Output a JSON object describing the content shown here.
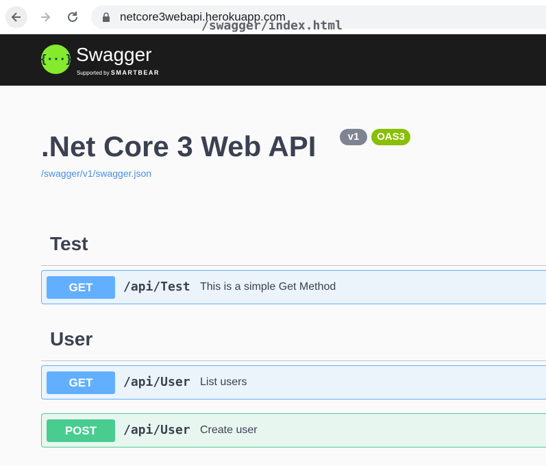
{
  "browser": {
    "url_host": "netcore3webapi.herokuapp.com",
    "url_path": "/swagger/index.html"
  },
  "topbar": {
    "logo_mark": "{···}",
    "logo_text": "Swagger",
    "logo_sub_prefix": "Supported by",
    "logo_sub_brand": "SMARTBEAR"
  },
  "info": {
    "title": ".Net Core 3 Web API",
    "version_badge": "v1",
    "oas_badge": "OAS3",
    "spec_link": "/swagger/v1/swagger.json"
  },
  "tags": [
    {
      "name": "Test",
      "operations": [
        {
          "method": "GET",
          "path": "/api/Test",
          "summary": "This is a simple Get Method"
        }
      ]
    },
    {
      "name": "User",
      "operations": [
        {
          "method": "GET",
          "path": "/api/User",
          "summary": "List users"
        },
        {
          "method": "POST",
          "path": "/api/User",
          "summary": "Create user"
        }
      ]
    }
  ],
  "colors": {
    "get": "#61affe",
    "post": "#49cc90",
    "topbar": "#1b1b1b",
    "logo_green": "#85ea2d"
  },
  "icons": [
    "back-arrow-icon",
    "forward-arrow-icon",
    "reload-icon",
    "lock-icon",
    "swagger-logo-icon"
  ]
}
